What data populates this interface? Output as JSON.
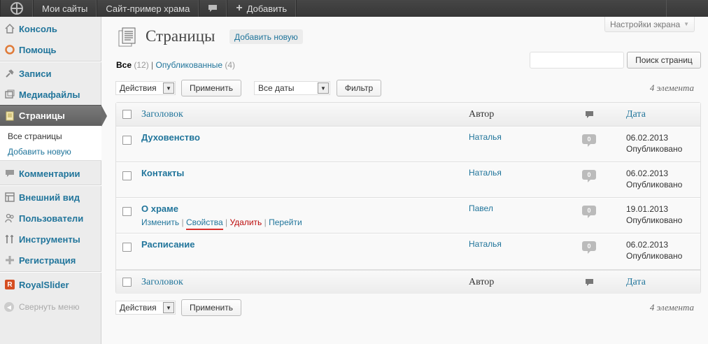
{
  "adminbar": {
    "logo_icon": "wordpress-logo-icon",
    "my_sites": "Мои сайты",
    "site_name": "Сайт-пример храма",
    "comments_icon": "comment-bubble-icon",
    "add_new": "Добавить"
  },
  "sidebar": {
    "items": [
      {
        "label": "Консоль",
        "icon": "home-icon"
      },
      {
        "label": "Помощь",
        "icon": "lifebuoy-icon"
      },
      {
        "label": "Записи",
        "icon": "pushpin-icon"
      },
      {
        "label": "Медиафайлы",
        "icon": "media-icon"
      },
      {
        "label": "Страницы",
        "icon": "pages-icon"
      },
      {
        "label": "Комментарии",
        "icon": "comments-icon"
      },
      {
        "label": "Внешний вид",
        "icon": "appearance-icon"
      },
      {
        "label": "Пользователи",
        "icon": "users-icon"
      },
      {
        "label": "Инструменты",
        "icon": "tools-icon"
      },
      {
        "label": "Регистрация",
        "icon": "registration-icon"
      },
      {
        "label": "RoyalSlider",
        "icon": "royalslider-icon"
      }
    ],
    "submenu": {
      "current": "Все страницы",
      "add": "Добавить новую"
    },
    "collapse": "Свернуть меню"
  },
  "header": {
    "screen_options": "Настройки экрана",
    "title": "Страницы",
    "add_new": "Добавить новую"
  },
  "filters": {
    "all_label": "Все",
    "all_count": "(12)",
    "separator": "|",
    "published_label": "Опубликованные",
    "published_count": "(4)"
  },
  "search": {
    "value": "",
    "button": "Поиск страниц"
  },
  "bulk_top": {
    "actions_value": "Действия",
    "apply": "Применить",
    "dates_value": "Все даты",
    "filter": "Фильтр",
    "count": "4 элемента"
  },
  "bulk_bottom": {
    "actions_value": "Действия",
    "apply": "Применить",
    "count": "4 элемента"
  },
  "table": {
    "columns": {
      "title": "Заголовок",
      "author": "Автор",
      "date": "Дата"
    },
    "rows": [
      {
        "title": "Духовенство",
        "author": "Наталья",
        "comments": "0",
        "date": "06.02.2013",
        "status": "Опубликовано"
      },
      {
        "title": "Контакты",
        "author": "Наталья",
        "comments": "0",
        "date": "06.02.2013",
        "status": "Опубликовано"
      },
      {
        "title": "О храме",
        "author": "Павел",
        "comments": "0",
        "date": "19.01.2013",
        "status": "Опубликовано",
        "actions": {
          "edit": "Изменить",
          "sep": "|",
          "props": "Свойства",
          "delete": "Удалить",
          "view": "Перейти"
        }
      },
      {
        "title": "Расписание",
        "author": "Наталья",
        "comments": "0",
        "date": "06.02.2013",
        "status": "Опубликовано"
      }
    ]
  },
  "colors": {
    "link": "#21759b",
    "current_menu": "#6d6d6d",
    "delete": "#bc0b0b",
    "highlight_underline": "#d9302c"
  }
}
